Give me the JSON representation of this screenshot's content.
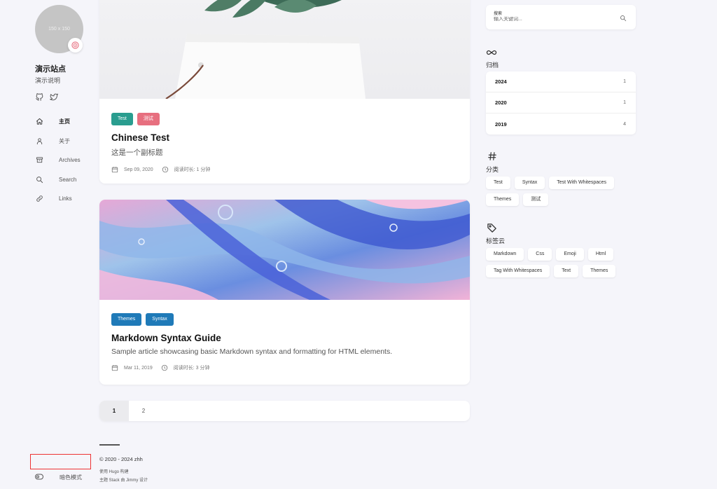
{
  "sidebar": {
    "avatar_placeholder": "150 x 150",
    "avatar_emoji": "🍥",
    "site_name": "演示站点",
    "site_description": "演示说明",
    "social": [
      "github-icon",
      "twitter-icon"
    ],
    "menu": [
      {
        "label": "主页",
        "icon": "home-icon",
        "active": true
      },
      {
        "label": "关于",
        "icon": "user-icon",
        "active": false
      },
      {
        "label": "Archives",
        "icon": "archive-icon",
        "active": false
      },
      {
        "label": "Search",
        "icon": "search-icon",
        "active": false
      },
      {
        "label": "Links",
        "icon": "link-icon",
        "active": false
      }
    ],
    "dark_mode_label": "暗色模式"
  },
  "articles": [
    {
      "tags": [
        {
          "label": "Test",
          "color": "#2a9d8f"
        },
        {
          "label": "测试",
          "color": "#e76f7f"
        }
      ],
      "title": "Chinese Test",
      "subtitle": "这是一个副标题",
      "date": "Sep 09, 2020",
      "read_time": "阅读时长: 1 分钟"
    },
    {
      "tags": [
        {
          "label": "Themes",
          "color": "#1f7ab8"
        },
        {
          "label": "Syntax",
          "color": "#1f7ab8"
        }
      ],
      "title": "Markdown Syntax Guide",
      "subtitle": "Sample article showcasing basic Markdown syntax and formatting for HTML elements.",
      "date": "Mar 11, 2019",
      "read_time": "阅读时长: 3 分钟"
    }
  ],
  "pagination": {
    "pages": [
      "1",
      "2"
    ],
    "current": "1"
  },
  "footer": {
    "copyright": "© 2020 - 2024 zhh",
    "powered": "使用 Hugo 构建",
    "theme": "主题 Stack 由 Jimmy 设计"
  },
  "search": {
    "label": "搜索",
    "placeholder": "输入关键词..."
  },
  "archives": {
    "title": "归档",
    "rows": [
      {
        "year": "2024",
        "count": "1"
      },
      {
        "year": "2020",
        "count": "1"
      },
      {
        "year": "2019",
        "count": "4"
      }
    ]
  },
  "categories": {
    "title": "分类",
    "items": [
      "Test",
      "Syntax",
      "Test With Whitespaces",
      "Themes",
      "测试"
    ]
  },
  "tag_cloud": {
    "title": "标签云",
    "items": [
      "Markdown",
      "Css",
      "Emoji",
      "Html",
      "Tag With Whitespaces",
      "Text",
      "Themes"
    ]
  }
}
